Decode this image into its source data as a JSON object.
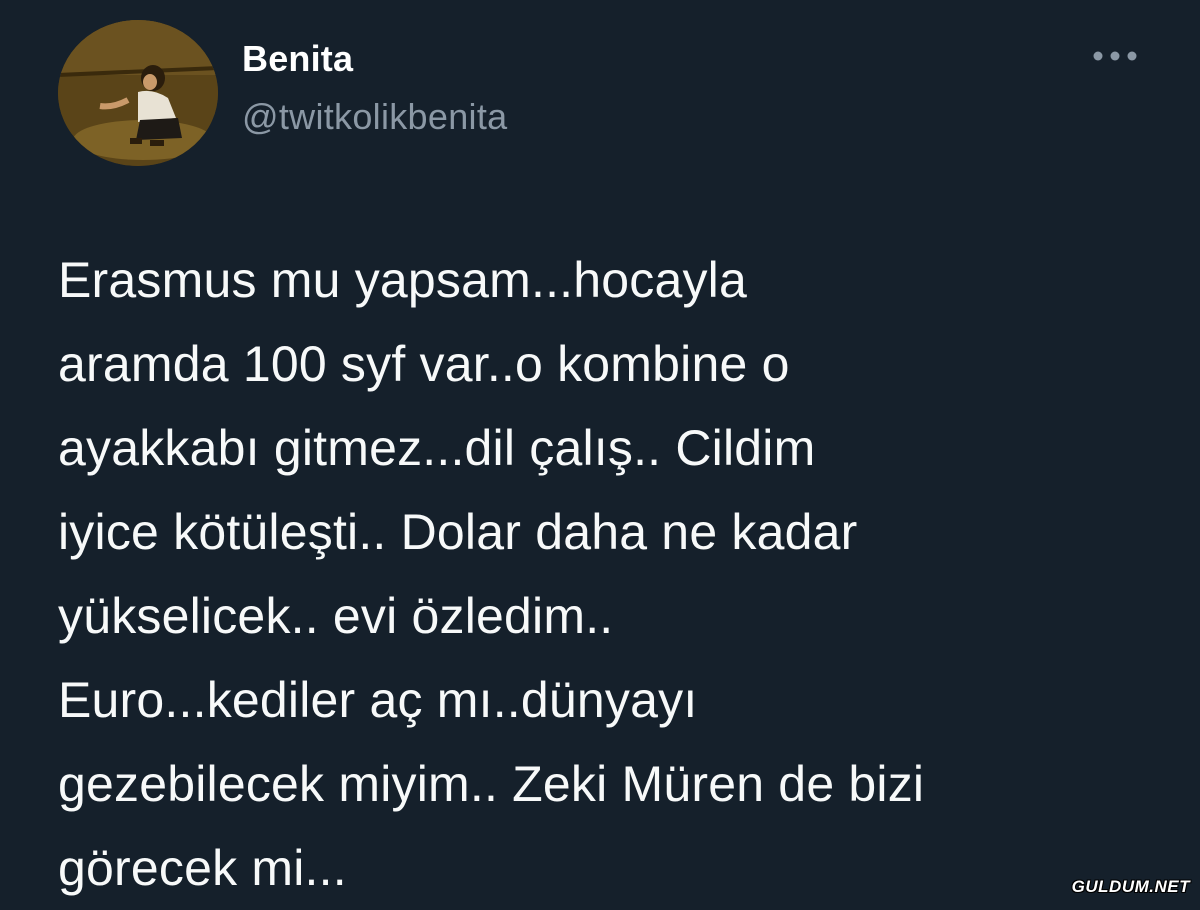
{
  "author": {
    "display_name": "Benita",
    "handle": "@twitkolikbenita"
  },
  "more_icon": "more-horizontal-icon",
  "tweet": {
    "text": "Erasmus mu yapsam...hocayla\naramda 100 syf var..o kombine o\nayakkabı gitmez...dil çalış.. Cildim\niyice kötüleşti.. Dolar daha ne kadar\nyükselicek.. evi özledim..\nEuro...kediler aç mı..dünyayı\ngezebilecek miyim.. Zeki Müren de bizi\ngörecek mi..."
  },
  "watermark": "GULDUM.NET",
  "colors": {
    "background": "#15202b",
    "text_primary": "#f7f9f9",
    "text_secondary": "#8b98a5"
  }
}
